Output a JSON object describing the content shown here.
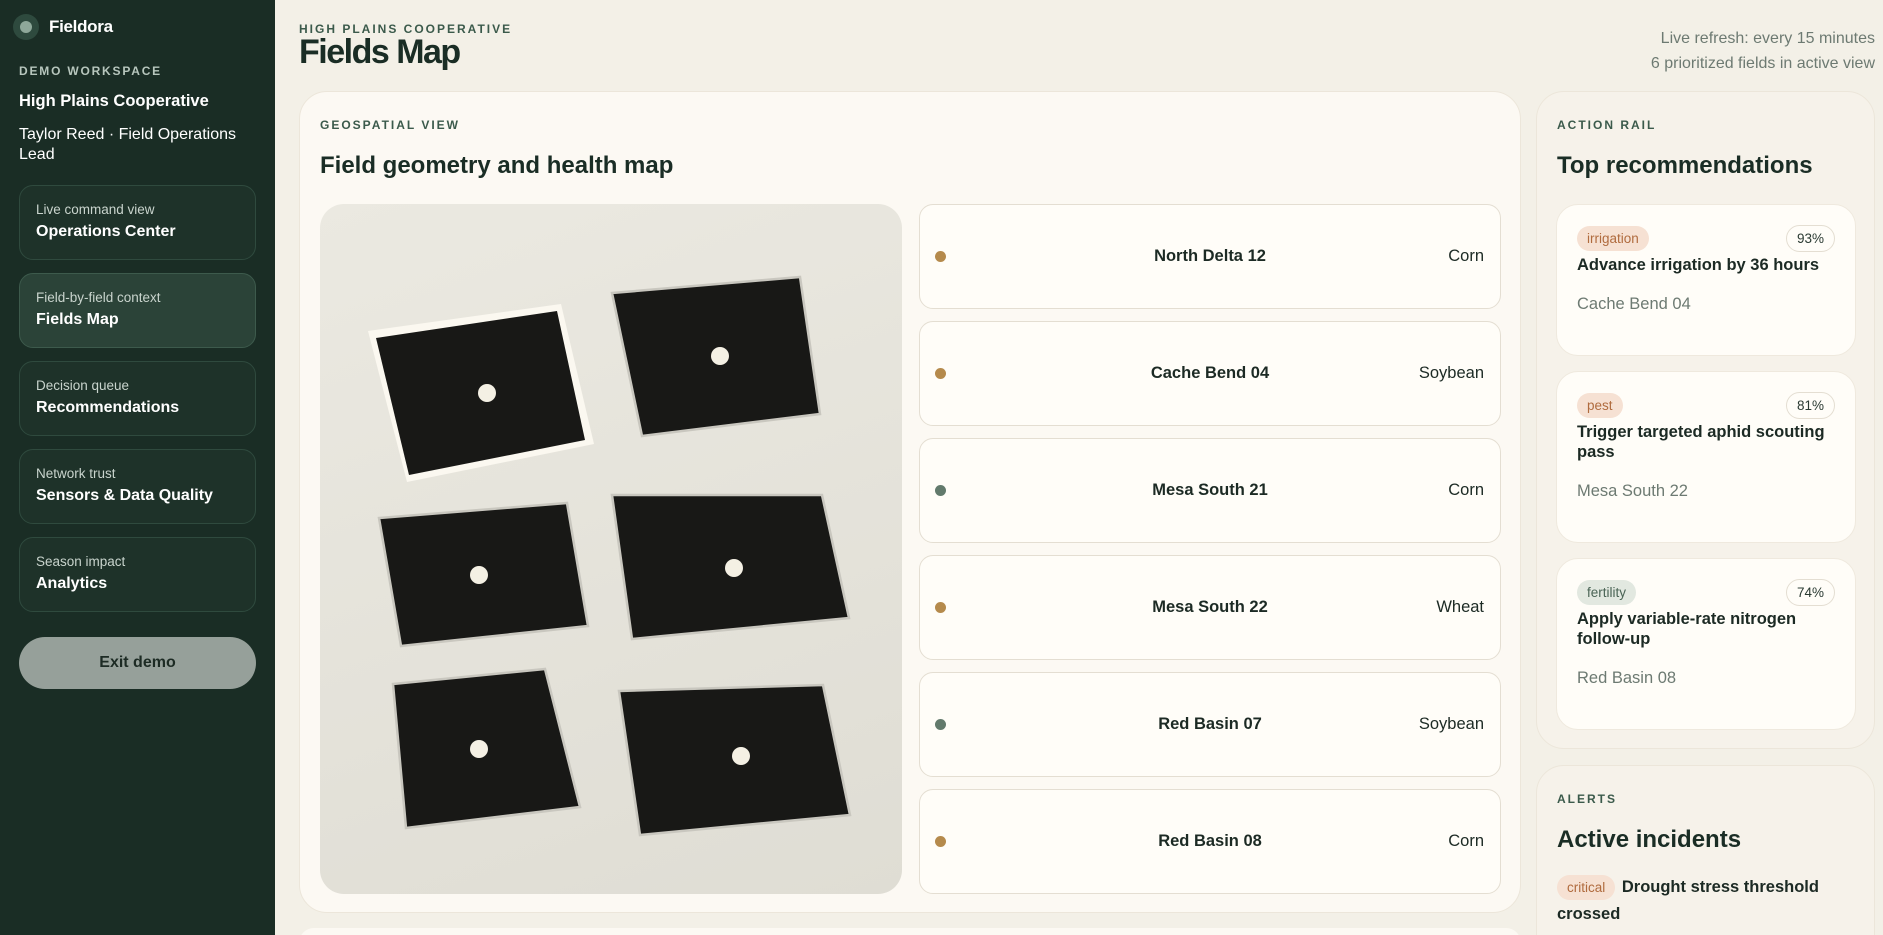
{
  "brand": {
    "name": "Fieldora"
  },
  "workspace": {
    "label": "DEMO WORKSPACE",
    "name": "High Plains Cooperative",
    "user": "Taylor Reed · Field Operations Lead"
  },
  "nav": [
    {
      "sub": "Live command view",
      "title": "Operations Center"
    },
    {
      "sub": "Field-by-field context",
      "title": "Fields Map"
    },
    {
      "sub": "Decision queue",
      "title": "Recommendations"
    },
    {
      "sub": "Network trust",
      "title": "Sensors & Data Quality"
    },
    {
      "sub": "Season impact",
      "title": "Analytics"
    }
  ],
  "exit_label": "Exit demo",
  "header": {
    "eyebrow": "HIGH PLAINS COOPERATIVE",
    "title": "Fields Map",
    "refresh": "Live refresh: every 15 minutes",
    "count": "6 prioritized fields in active view"
  },
  "map": {
    "eyebrow": "GEOSPATIAL VIEW",
    "title": "Field geometry and health map"
  },
  "fields": [
    {
      "name": "North Delta 12",
      "crop": "Corn",
      "status_color": "#b58a4c"
    },
    {
      "name": "Cache Bend 04",
      "crop": "Soybean",
      "status_color": "#b58a4c"
    },
    {
      "name": "Mesa South 21",
      "crop": "Corn",
      "status_color": "#627a6c"
    },
    {
      "name": "Mesa South 22",
      "crop": "Wheat",
      "status_color": "#b58a4c"
    },
    {
      "name": "Red Basin 07",
      "crop": "Soybean",
      "status_color": "#627a6c"
    },
    {
      "name": "Red Basin 08",
      "crop": "Corn",
      "status_color": "#b58a4c"
    }
  ],
  "action_rail": {
    "eyebrow": "ACTION RAIL",
    "title": "Top recommendations",
    "items": [
      {
        "tag": "irrigation",
        "confidence": "93%",
        "title": "Advance irrigation by 36 hours",
        "field": "Cache Bend 04"
      },
      {
        "tag": "pest",
        "confidence": "81%",
        "title": "Trigger targeted aphid scouting pass",
        "field": "Mesa South 22"
      },
      {
        "tag": "fertility",
        "confidence": "74%",
        "title": "Apply variable-rate nitrogen follow-up",
        "field": "Red Basin 08"
      }
    ]
  },
  "alerts": {
    "eyebrow": "ALERTS",
    "title": "Active incidents",
    "items": [
      {
        "severity": "critical",
        "title": "Drought stress threshold crossed"
      }
    ]
  }
}
